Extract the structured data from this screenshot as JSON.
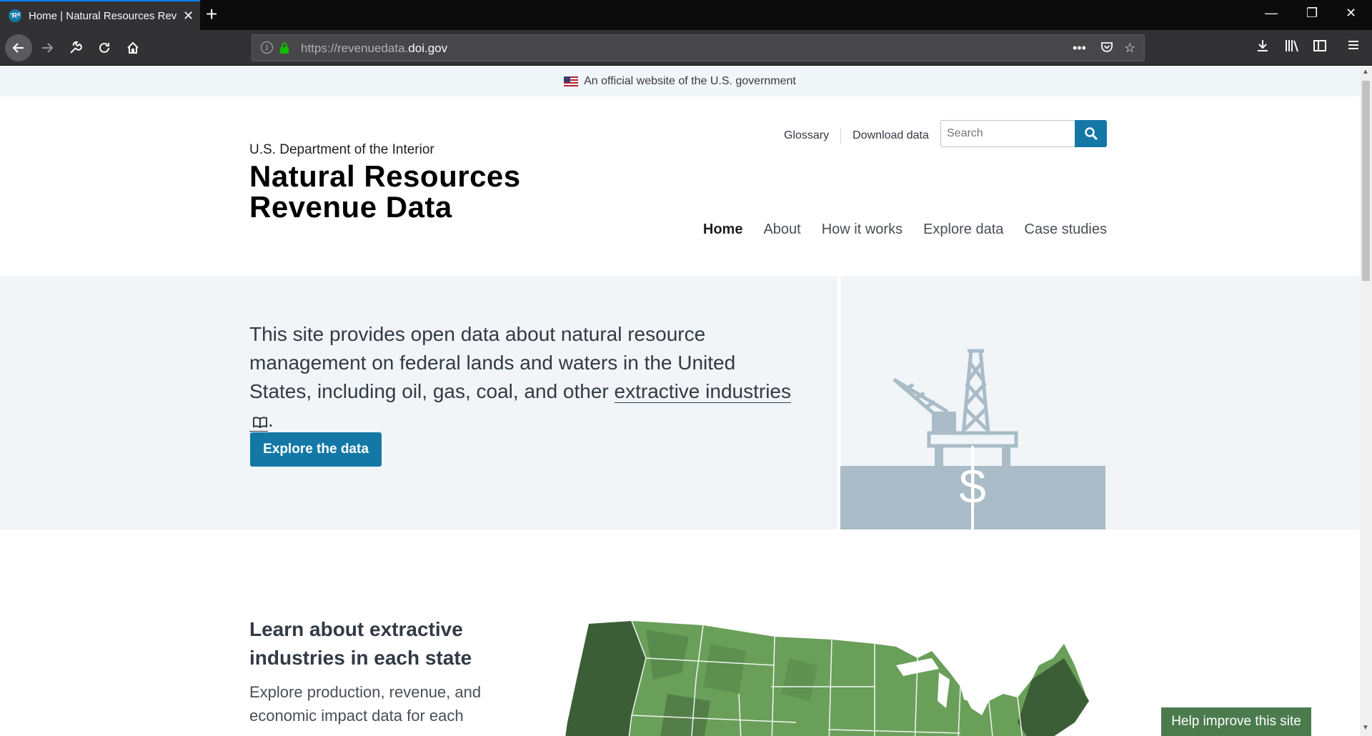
{
  "browser": {
    "tab_title": "Home | Natural Resources Reve",
    "tab_favicon": "ʼRᵈ",
    "url_prefix": "https://revenuedata.",
    "url_domain": "doi.gov",
    "accent_color": "#0a84ff"
  },
  "gov_banner": {
    "text": "An official website of the U.S. government"
  },
  "header": {
    "agency": "U.S. Department of the Interior",
    "site_name_line1": "Natural Resources",
    "site_name_line2": "Revenue Data",
    "util_links": [
      "Glossary",
      "Download data"
    ],
    "search_placeholder": "Search",
    "nav": [
      "Home",
      "About",
      "How it works",
      "Explore data",
      "Case studies"
    ],
    "active_nav": "Home"
  },
  "hero": {
    "text_before_link": "This site provides open data about natural resource management on federal lands and waters in the United States, including oil, gas, coal, and other ",
    "link_text": "extractive industries",
    "text_after_link": ".",
    "button_label": "Explore the data",
    "illustration": "offshore-oil-rig-dollar-icon"
  },
  "states_section": {
    "title": "Learn about extractive industries in each state",
    "description": "Explore production, revenue, and economic impact data for each"
  },
  "help_button": {
    "label": "Help improve this site"
  },
  "colors": {
    "brand_blue": "#1478a7",
    "map_dark_green": "#3b5e36",
    "map_light_green": "#6a9f5a",
    "help_green": "#4b7b4d"
  }
}
